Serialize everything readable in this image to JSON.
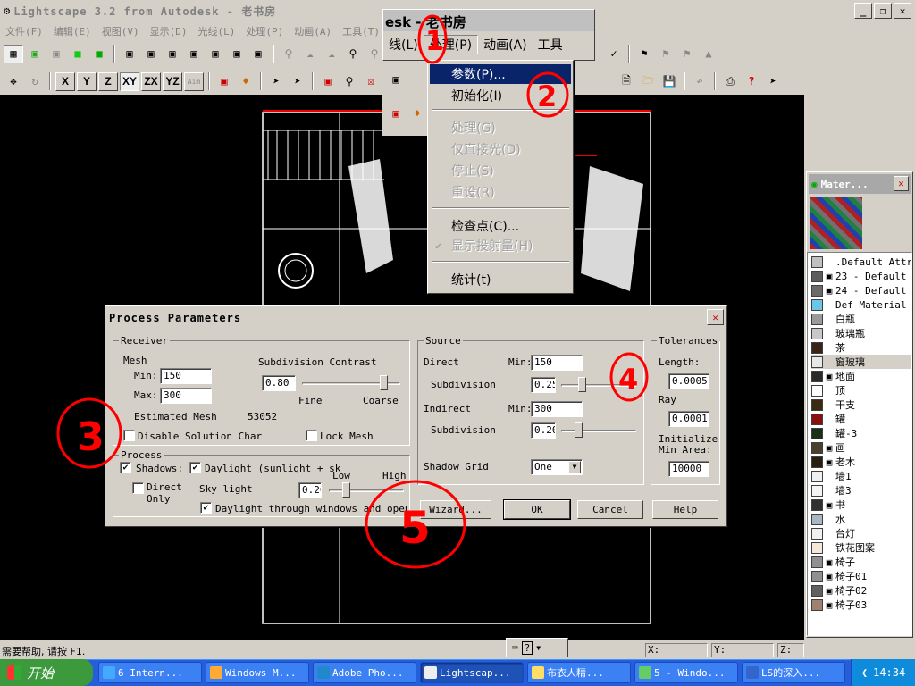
{
  "window": {
    "title": "Lightscape 3.2 from Autodesk - 老书房"
  },
  "menubar": [
    "文件(F)",
    "编辑(E)",
    "视图(V)",
    "显示(D)",
    "光线(L)",
    "处理(P)",
    "动画(A)",
    "工具(T)"
  ],
  "floating_menubar": {
    "title_fragment": "esk - 老书房",
    "items": [
      "线(L)",
      "处理(P)",
      "动画(A)",
      "工具"
    ]
  },
  "axis_buttons": [
    "X",
    "Y",
    "Z",
    "XY",
    "ZX",
    "YZ",
    "Aim"
  ],
  "process_menu": {
    "items": [
      {
        "label": "参数(P)...",
        "enabled": true,
        "selected": true
      },
      {
        "label": "初始化(I)",
        "enabled": true
      },
      {
        "label": "处理(G)",
        "enabled": false
      },
      {
        "label": "仅直接光(D)",
        "enabled": false
      },
      {
        "label": "停止(S)",
        "enabled": false
      },
      {
        "label": "重设(R)",
        "enabled": false
      },
      {
        "label": "检查点(C)...",
        "enabled": true
      },
      {
        "label": "显示投射量(H)",
        "enabled": false,
        "checked": true
      },
      {
        "label": "统计(t)",
        "enabled": true
      }
    ]
  },
  "dialog": {
    "title": "Process Parameters",
    "receiver": {
      "label": "Receiver",
      "mesh_label": "Mesh",
      "min_label": "Min:",
      "min_value": "150",
      "max_label": "Max:",
      "max_value": "300",
      "subdivision_contrast_label": "Subdivision Contrast",
      "subdivision_contrast_value": "0.80",
      "fine_label": "Fine",
      "coarse_label": "Coarse",
      "slider_value": 0.86,
      "estimated_mesh_label": "Estimated Mesh",
      "estimated_mesh_value": "53052",
      "disable_solution_label": "Disable Solution Char",
      "disable_solution_checked": false,
      "lock_mesh_label": "Lock Mesh",
      "lock_mesh_checked": false
    },
    "process": {
      "label": "Process",
      "shadows_label": "Shadows:",
      "shadows_checked": true,
      "daylight_label": "Daylight (sunlight + sk",
      "daylight_checked": true,
      "direct_only_label": "Direct Only",
      "direct_only_checked": false,
      "sky_light_label": "Sky light",
      "sky_light_value": "0.20",
      "low_label": "Low",
      "high_label": "High",
      "sky_slider_value": 0.2,
      "daylight_windows_label": "Daylight through windows and opening",
      "daylight_windows_checked": true
    },
    "source": {
      "label": "Source",
      "direct_label": "Direct",
      "direct_min_label": "Min:",
      "direct_min_value": "150",
      "direct_subdivision_label": "Subdivision",
      "direct_subdivision_value": "0.25",
      "direct_slider_value": 0.25,
      "indirect_label": "Indirect",
      "indirect_min_label": "Min:",
      "indirect_min_value": "300",
      "indirect_subdivision_label": "Subdivision",
      "indirect_subdivision_value": "0.20",
      "indirect_slider_value": 0.2,
      "shadow_grid_label": "Shadow Grid",
      "shadow_grid_value": "One"
    },
    "tolerances": {
      "label": "Tolerances",
      "length_label": "Length:",
      "length_value": "0.0005",
      "ray_label": "Ray",
      "ray_value": "0.0001",
      "init_min_area_label": "Initialize Min Area:",
      "init_min_area_value": "10000"
    },
    "buttons": {
      "wizard": "Wizard...",
      "ok": "OK",
      "cancel": "Cancel",
      "help": "Help"
    }
  },
  "materials": {
    "title": "Mater...",
    "items": [
      {
        "name": ".Default Attr",
        "color": "#c0c0c0",
        "cube": false
      },
      {
        "name": "23 - Default",
        "color": "#5c5c5c",
        "cube": true
      },
      {
        "name": "24 - Default",
        "color": "#6a6a6a",
        "cube": true
      },
      {
        "name": "Def Material",
        "color": "#6cc6e8",
        "cube": false
      },
      {
        "name": "白瓶",
        "color": "#9a9a9a",
        "cube": false
      },
      {
        "name": "玻璃瓶",
        "color": "#c8c8c8",
        "cube": false
      },
      {
        "name": "茶",
        "color": "#3a2418",
        "cube": false
      },
      {
        "name": "窗玻璃",
        "color": "#e8e8e8",
        "cube": false,
        "selected": true
      },
      {
        "name": "地面",
        "color": "#2a2a2a",
        "cube": true
      },
      {
        "name": "顶",
        "color": "#ffffff",
        "cube": false
      },
      {
        "name": "干支",
        "color": "#3a2a14",
        "cube": false
      },
      {
        "name": "罐",
        "color": "#8a1010",
        "cube": false
      },
      {
        "name": "罐-3",
        "color": "#183018",
        "cube": false
      },
      {
        "name": "画",
        "color": "#4a4030",
        "cube": true
      },
      {
        "name": "老木",
        "color": "#2a1c10",
        "cube": true
      },
      {
        "name": "墙1",
        "color": "#f0f0f0",
        "cube": false
      },
      {
        "name": "墙3",
        "color": "#f4f4f4",
        "cube": false
      },
      {
        "name": "书",
        "color": "#303030",
        "cube": true
      },
      {
        "name": "水",
        "color": "#a8b8c0",
        "cube": false
      },
      {
        "name": "台灯",
        "color": "#f0f0f0",
        "cube": false
      },
      {
        "name": "铁花图案",
        "color": "#f4e8d8",
        "cube": false
      },
      {
        "name": "椅子",
        "color": "#909090",
        "cube": true
      },
      {
        "name": "椅子01",
        "color": "#909090",
        "cube": true
      },
      {
        "name": "椅子02",
        "color": "#606060",
        "cube": true
      },
      {
        "name": "椅子03",
        "color": "#a08070",
        "cube": true
      }
    ]
  },
  "status": {
    "help_text": "需要帮助, 请按 F1.",
    "x_label": "X:",
    "y_label": "Y:",
    "z_label": "Z:"
  },
  "taskbar": {
    "start_label": "开始",
    "tasks": [
      "6 Intern...",
      "Windows M...",
      "Adobe Pho...",
      "Lightscap...",
      "布衣人精...",
      "5 - Windo...",
      "LS的深入..."
    ],
    "clock": "14:34"
  },
  "annotations": [
    "1",
    "2",
    "3",
    "4",
    "5"
  ],
  "colors": {
    "annotation": "#ff0000",
    "selection": "#0a246a",
    "taskbar": "#245edb",
    "start": "#3c9a3c"
  }
}
